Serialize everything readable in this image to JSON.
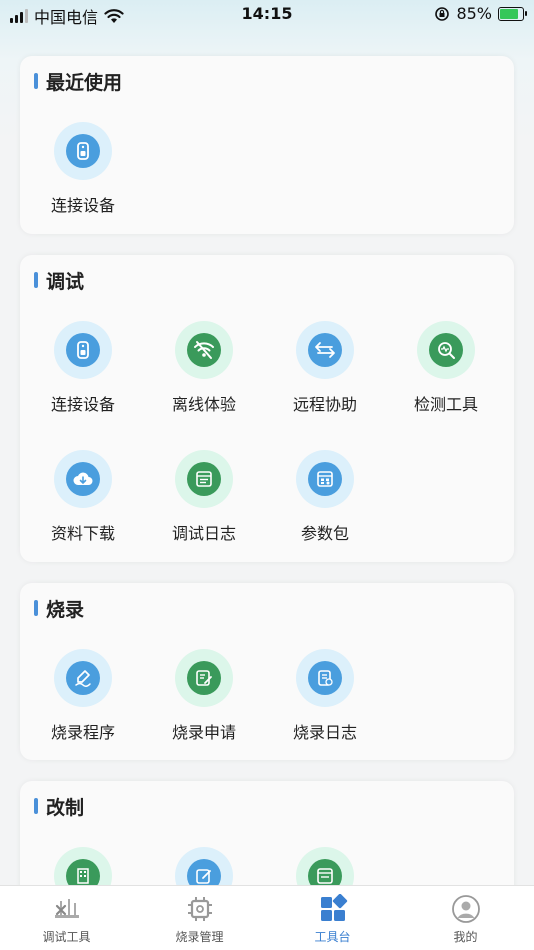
{
  "status_bar": {
    "carrier": "中国电信",
    "time": "14:15",
    "battery": "85%"
  },
  "sections": {
    "recent": {
      "title": "最近使用",
      "items": [
        {
          "label": "连接设备"
        }
      ]
    },
    "debug": {
      "title": "调试",
      "items": [
        {
          "label": "连接设备"
        },
        {
          "label": "离线体验"
        },
        {
          "label": "远程协助"
        },
        {
          "label": "检测工具"
        },
        {
          "label": "资料下载"
        },
        {
          "label": "调试日志"
        },
        {
          "label": "参数包"
        }
      ]
    },
    "flash": {
      "title": "烧录",
      "items": [
        {
          "label": "烧录程序"
        },
        {
          "label": "烧录申请"
        },
        {
          "label": "烧录日志"
        }
      ]
    },
    "modify": {
      "title": "改制"
    }
  },
  "tab_bar": {
    "tabs": [
      {
        "label": "调试工具"
      },
      {
        "label": "烧录管理"
      },
      {
        "label": "工具台"
      },
      {
        "label": "我的"
      }
    ],
    "active_color": "#3a7fd0",
    "inactive_color": "#999999"
  }
}
